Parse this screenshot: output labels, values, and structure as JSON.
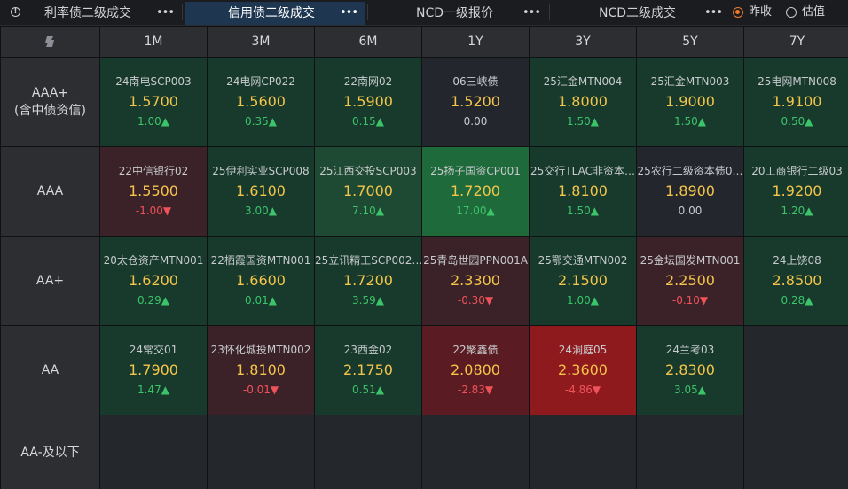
{
  "tabs": [
    {
      "label": "利率债二级成交",
      "active": false
    },
    {
      "label": "信用债二级成交",
      "active": true
    },
    {
      "label": "NCD一级报价",
      "active": false
    },
    {
      "label": "NCD二级成交",
      "active": false
    }
  ],
  "more_glyph": "•••",
  "radios": [
    {
      "label": "昨收",
      "checked": true
    },
    {
      "label": "估值",
      "checked": false
    }
  ],
  "corner_label": "B",
  "tenors": [
    "1M",
    "3M",
    "6M",
    "1Y",
    "3Y",
    "5Y",
    "7Y"
  ],
  "ratings": [
    {
      "label": "AAA+",
      "sub": "(含中债资信)"
    },
    {
      "label": "AAA",
      "sub": ""
    },
    {
      "label": "AA+",
      "sub": ""
    },
    {
      "label": "AA",
      "sub": ""
    },
    {
      "label": "AA-及以下",
      "sub": ""
    }
  ],
  "colors": {
    "dark_green": "#173a2c",
    "mid_green": "#1e4a33",
    "bright_green": "#1f6a3b",
    "neutral": "#23272d",
    "dark_red": "#3a2228",
    "mid_red": "#5a1c22",
    "bright_red": "#8e1a1e",
    "yield": "#f5c54a",
    "up": "#3cc46a",
    "down": "#f0525a",
    "accent": "#f07a2a"
  },
  "cells": [
    [
      {
        "name": "24南电SCP003",
        "yield": "1.5700",
        "change": "1.00▲",
        "dir": "up",
        "bg": "dark_green"
      },
      {
        "name": "24电网CP022",
        "yield": "1.5600",
        "change": "0.35▲",
        "dir": "up",
        "bg": "dark_green"
      },
      {
        "name": "22南网02",
        "yield": "1.5900",
        "change": "0.15▲",
        "dir": "up",
        "bg": "dark_green"
      },
      {
        "name": "06三峡债",
        "yield": "1.5200",
        "change": "0.00",
        "dir": "flat",
        "bg": "neutral"
      },
      {
        "name": "25汇金MTN004",
        "yield": "1.8000",
        "change": "1.50▲",
        "dir": "up",
        "bg": "dark_green"
      },
      {
        "name": "25汇金MTN003",
        "yield": "1.9000",
        "change": "1.50▲",
        "dir": "up",
        "bg": "dark_green"
      },
      {
        "name": "25电网MTN008",
        "yield": "1.9100",
        "change": "0.50▲",
        "dir": "up",
        "bg": "dark_green"
      }
    ],
    [
      {
        "name": "22中信银行02",
        "yield": "1.5500",
        "change": "-1.00▼",
        "dir": "down",
        "bg": "dark_red"
      },
      {
        "name": "25伊利实业SCP008",
        "yield": "1.6100",
        "change": "3.00▲",
        "dir": "up",
        "bg": "dark_green"
      },
      {
        "name": "25江西交投SCP003",
        "yield": "1.7000",
        "change": "7.10▲",
        "dir": "up",
        "bg": "mid_green"
      },
      {
        "name": "25扬子国资CP001",
        "yield": "1.7200",
        "change": "17.00▲",
        "dir": "up",
        "bg": "bright_green"
      },
      {
        "name": "25交行TLAC非资本…",
        "yield": "1.8100",
        "change": "1.50▲",
        "dir": "up",
        "bg": "dark_green"
      },
      {
        "name": "25农行二级资本债0…",
        "yield": "1.8900",
        "change": "0.00",
        "dir": "flat",
        "bg": "neutral"
      },
      {
        "name": "20工商银行二级03",
        "yield": "1.9200",
        "change": "1.20▲",
        "dir": "up",
        "bg": "dark_green"
      }
    ],
    [
      {
        "name": "20太仓资产MTN001",
        "yield": "1.6200",
        "change": "0.29▲",
        "dir": "up",
        "bg": "dark_green"
      },
      {
        "name": "22栖霞国资MTN001",
        "yield": "1.6600",
        "change": "0.01▲",
        "dir": "up",
        "bg": "dark_green"
      },
      {
        "name": "25立讯精工SCP002…",
        "yield": "1.7200",
        "change": "3.59▲",
        "dir": "up",
        "bg": "dark_green"
      },
      {
        "name": "25青岛世园PPN001A",
        "yield": "2.3300",
        "change": "-0.30▼",
        "dir": "down",
        "bg": "dark_red"
      },
      {
        "name": "25鄂交通MTN002",
        "yield": "2.1500",
        "change": "1.00▲",
        "dir": "up",
        "bg": "dark_green"
      },
      {
        "name": "25金坛国发MTN001",
        "yield": "2.2500",
        "change": "-0.10▼",
        "dir": "down",
        "bg": "dark_red"
      },
      {
        "name": "24上饶08",
        "yield": "2.8500",
        "change": "0.28▲",
        "dir": "up",
        "bg": "dark_green"
      }
    ],
    [
      {
        "name": "24常交01",
        "yield": "1.7900",
        "change": "1.47▲",
        "dir": "up",
        "bg": "dark_green"
      },
      {
        "name": "23怀化城投MTN002",
        "yield": "1.8100",
        "change": "-0.01▼",
        "dir": "down",
        "bg": "dark_red"
      },
      {
        "name": "23西金02",
        "yield": "2.1750",
        "change": "0.51▲",
        "dir": "up",
        "bg": "dark_green"
      },
      {
        "name": "22聚鑫债",
        "yield": "2.0800",
        "change": "-2.83▼",
        "dir": "down",
        "bg": "mid_red"
      },
      {
        "name": "24洞庭05",
        "yield": "2.3600",
        "change": "-4.86▼",
        "dir": "down",
        "bg": "bright_red"
      },
      {
        "name": "24兰考03",
        "yield": "2.8300",
        "change": "3.05▲",
        "dir": "up",
        "bg": "dark_green"
      },
      null
    ],
    [
      null,
      null,
      null,
      null,
      null,
      null,
      null
    ]
  ]
}
